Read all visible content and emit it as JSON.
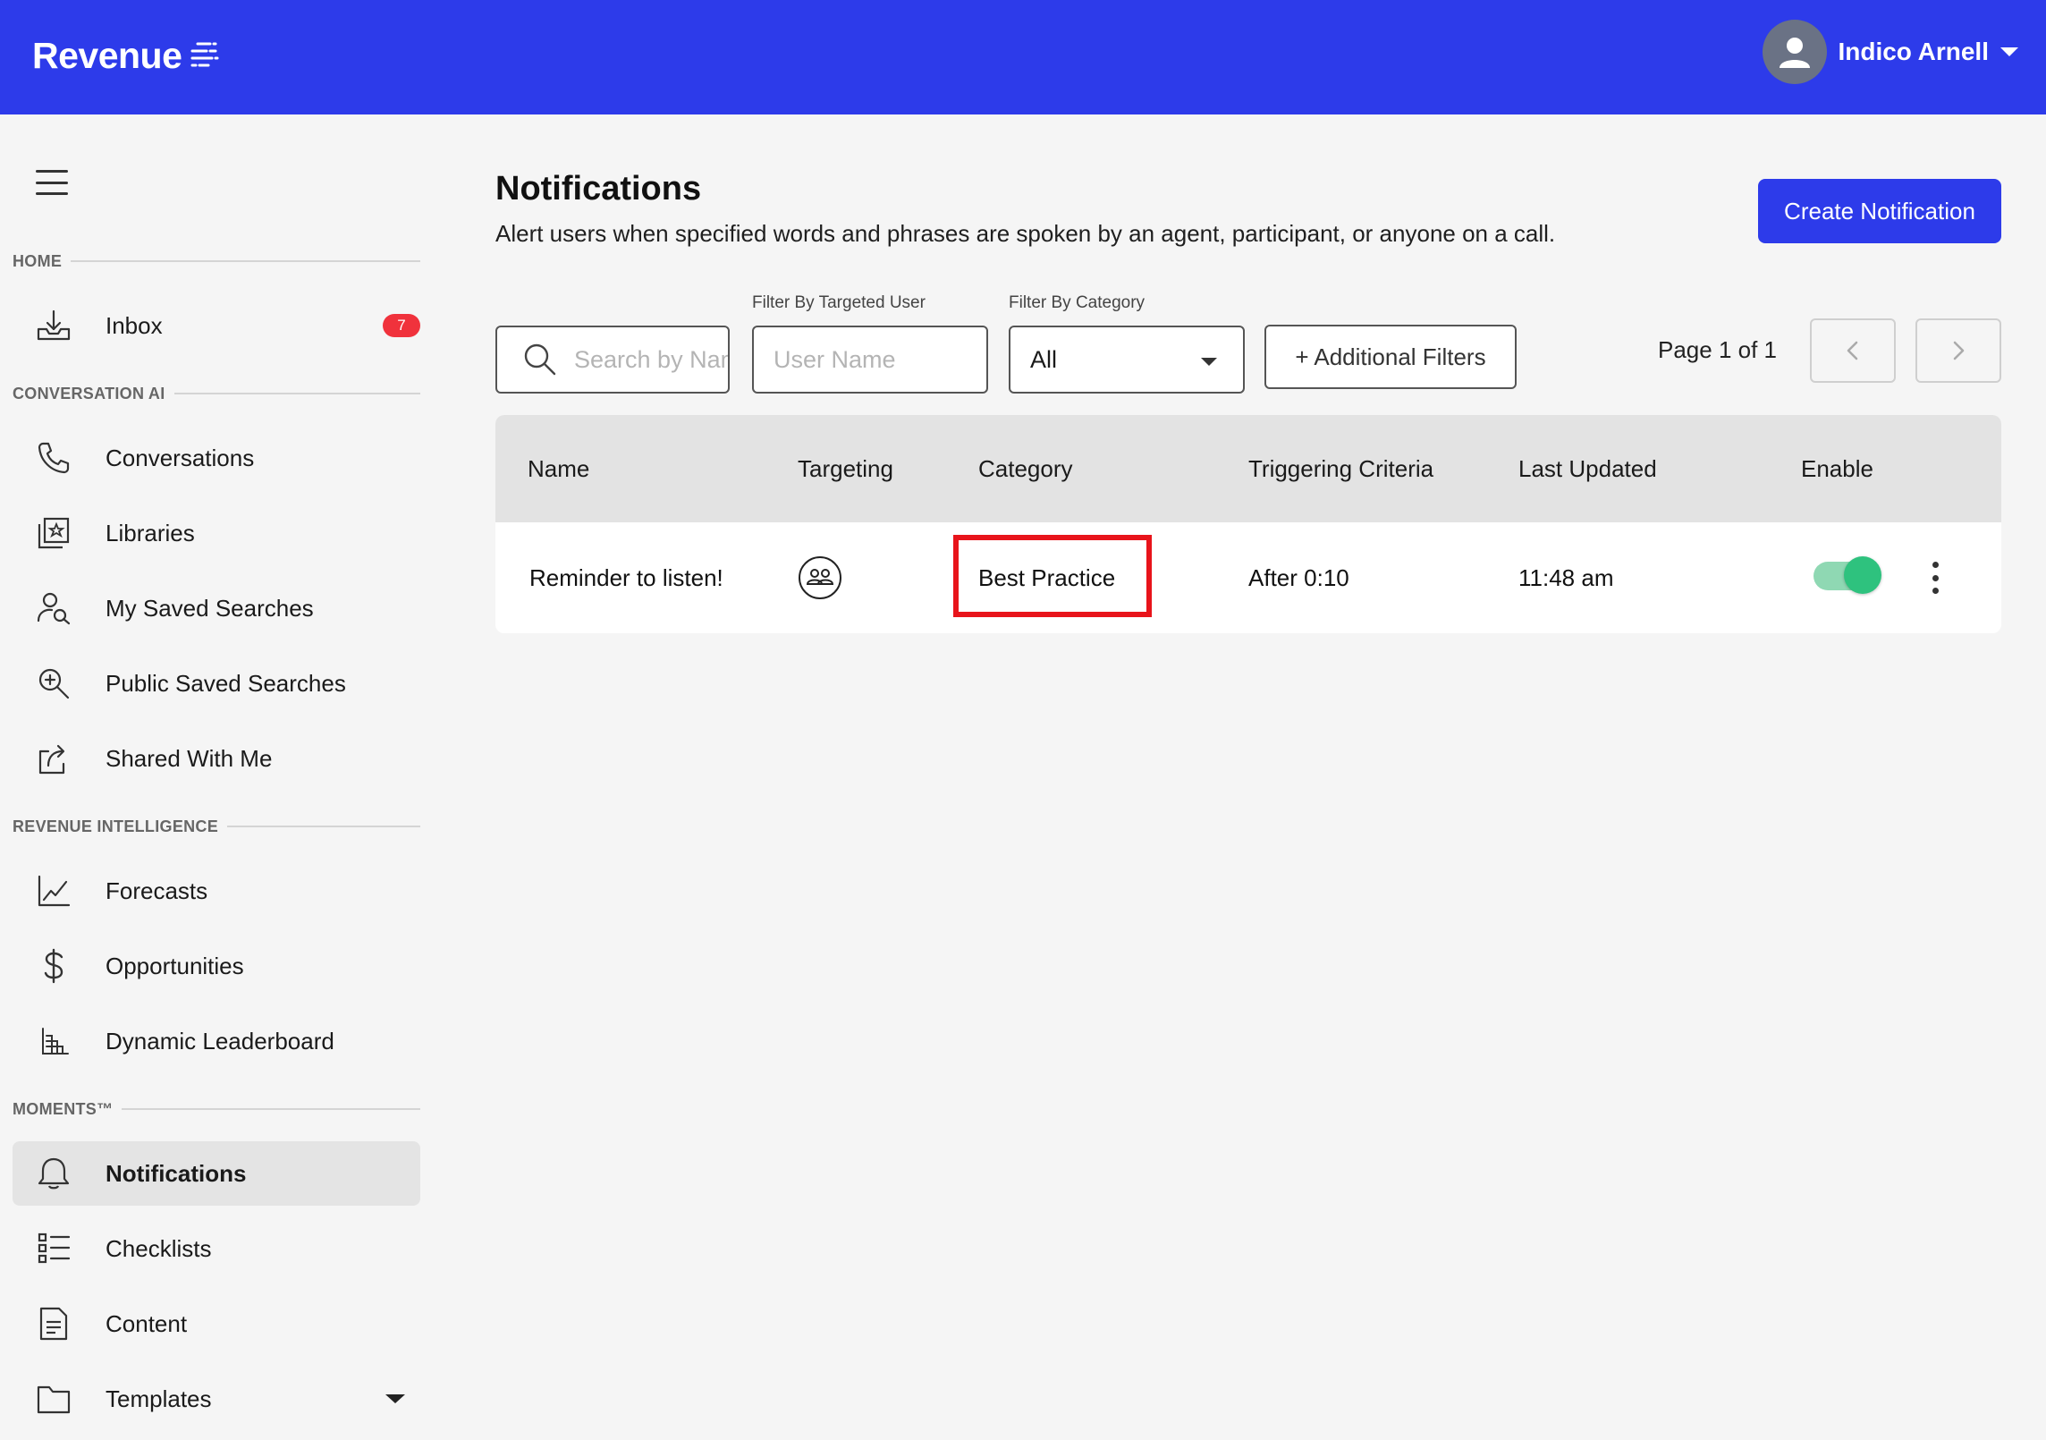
{
  "header": {
    "logo_text": "Revenue",
    "user_name": "Indico Arnell",
    "brand_color": "#2d3bea"
  },
  "sidebar": {
    "sections": {
      "home": "HOME",
      "conversation_ai": "CONVERSATION AI",
      "revenue_intelligence": "REVENUE INTELLIGENCE",
      "moments": "MOMENTS™"
    },
    "items": {
      "inbox": {
        "label": "Inbox",
        "badge": "7",
        "icon": "inbox-download-icon"
      },
      "conversations": {
        "label": "Conversations",
        "icon": "phone-icon"
      },
      "libraries": {
        "label": "Libraries",
        "icon": "library-icon"
      },
      "my_saved_searches": {
        "label": "My Saved Searches",
        "icon": "user-search-icon"
      },
      "public_saved_searches": {
        "label": "Public Saved Searches",
        "icon": "zoom-in-icon"
      },
      "shared_with_me": {
        "label": "Shared With Me",
        "icon": "share-icon"
      },
      "forecasts": {
        "label": "Forecasts",
        "icon": "line-chart-icon"
      },
      "opportunities": {
        "label": "Opportunities",
        "icon": "dollar-icon"
      },
      "dynamic_leaderboard": {
        "label": "Dynamic Leaderboard",
        "icon": "bar-chart-icon"
      },
      "notifications": {
        "label": "Notifications",
        "icon": "bell-icon",
        "active": true
      },
      "checklists": {
        "label": "Checklists",
        "icon": "checklist-icon"
      },
      "content": {
        "label": "Content",
        "icon": "document-icon"
      },
      "templates": {
        "label": "Templates",
        "icon": "folder-icon"
      }
    }
  },
  "main": {
    "title": "Notifications",
    "subtitle": "Alert users when specified words and phrases are spoken by an agent, participant, or anyone on a call.",
    "create_button": "Create Notification",
    "filters": {
      "search_placeholder": "Search by Name",
      "targeted_user_label": "Filter By Targeted User",
      "targeted_user_placeholder": "User Name",
      "category_label": "Filter By Category",
      "category_value": "All",
      "additional_filters": "+ Additional Filters"
    },
    "pagination": {
      "text": "Page 1 of 1"
    },
    "table": {
      "headers": {
        "name": "Name",
        "targeting": "Targeting",
        "category": "Category",
        "triggering": "Triggering Criteria",
        "last_updated": "Last Updated",
        "enable": "Enable"
      },
      "rows": [
        {
          "name": "Reminder to listen!",
          "targeting_icon": "group-icon",
          "category": "Best Practice",
          "triggering": "After 0:10",
          "last_updated": "11:48 am",
          "enabled": true
        }
      ],
      "highlight_color": "#e8141b",
      "toggle_color": "#2ec27e"
    }
  }
}
